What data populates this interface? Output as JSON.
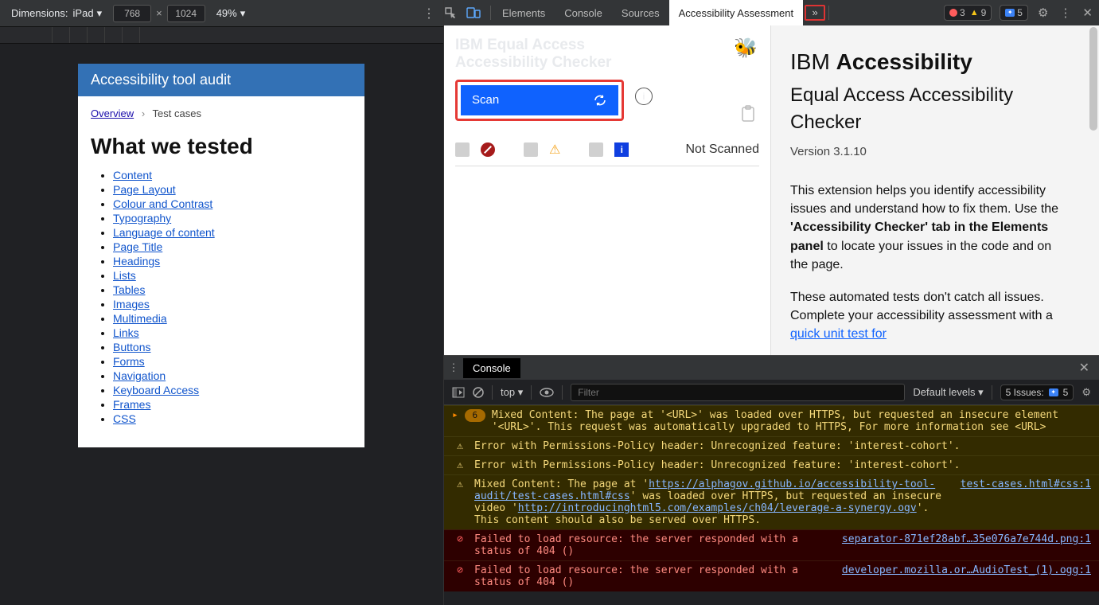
{
  "preview": {
    "dimensions_label": "Dimensions:",
    "device": "iPad",
    "width": "768",
    "height": "1024",
    "zoom": "49%"
  },
  "page": {
    "banner": "Accessibility tool audit",
    "breadcrumb": {
      "link": "Overview",
      "current": "Test cases"
    },
    "h1": "What we tested",
    "toc": [
      "Content",
      "Page Layout",
      "Colour and Contrast",
      "Typography",
      "Language of content",
      "Page Title",
      "Headings",
      "Lists",
      "Tables",
      "Images",
      "Multimedia",
      "Links",
      "Buttons",
      "Forms",
      "Navigation",
      "Keyboard Access",
      "Frames",
      "CSS"
    ]
  },
  "devtools": {
    "tabs": [
      "Elements",
      "Console",
      "Sources",
      "Accessibility Assessment"
    ],
    "active_tab": "Accessibility Assessment",
    "counts": {
      "errors": "3",
      "warnings": "9",
      "messages": "5"
    }
  },
  "checker": {
    "title_line1": "IBM Equal Access",
    "title_line2": "Accessibility Checker",
    "scan_label": "Scan",
    "status": "Not Scanned",
    "brand_pre": "IBM",
    "brand_bold": "Accessibility",
    "subtitle": "Equal Access Accessibility Checker",
    "version": "Version 3.1.10",
    "p1_pre": "This extension helps you identify accessibility issues and understand how to fix them. Use the ",
    "p1_bold": "'Accessibility Checker' tab in the Elements panel",
    "p1_post": " to locate your issues in the code and on the page.",
    "p2_pre": "These automated tests don't catch all issues. Complete your accessibility assessment with a ",
    "p2_link": "quick unit test for"
  },
  "console": {
    "tab": "Console",
    "context": "top",
    "filter_placeholder": "Filter",
    "levels": "Default levels",
    "issues_label": "5 Issues:",
    "issues_count": "5",
    "collapsed_count": "6",
    "messages": [
      {
        "type": "warn",
        "kind": "collapsed",
        "text": "Mixed Content: The page at '<URL>' was loaded over HTTPS, but requested an insecure element '<URL>'. This request was automatically upgraded to HTTPS, For more information see <URL>"
      },
      {
        "type": "warn",
        "text": "Error with Permissions-Policy header: Unrecognized feature: 'interest-cohort'."
      },
      {
        "type": "warn",
        "text": "Error with Permissions-Policy header: Unrecognized feature: 'interest-cohort'."
      },
      {
        "type": "warn",
        "text_parts": [
          "Mixed Content: The page at '",
          {
            "link": "https://alphagov.github.io/accessibility-tool-audit/test-cases.html#css"
          },
          "' was loaded over HTTPS, but requested an insecure video '",
          {
            "link": "http://introducinghtml5.com/examples/ch04/leverage-a-synergy.ogv"
          },
          "'. This content should also be served over HTTPS."
        ],
        "src": "test-cases.html#css:1"
      },
      {
        "type": "err",
        "text": "Failed to load resource: the server responded with a status of 404 ()",
        "src": "separator-871ef28abf…35e076a7e744d.png:1"
      },
      {
        "type": "err",
        "text": "Failed to load resource: the server responded with a status of 404 ()",
        "src": "developer.mozilla.or…AudioTest_(1).ogg:1"
      }
    ]
  }
}
